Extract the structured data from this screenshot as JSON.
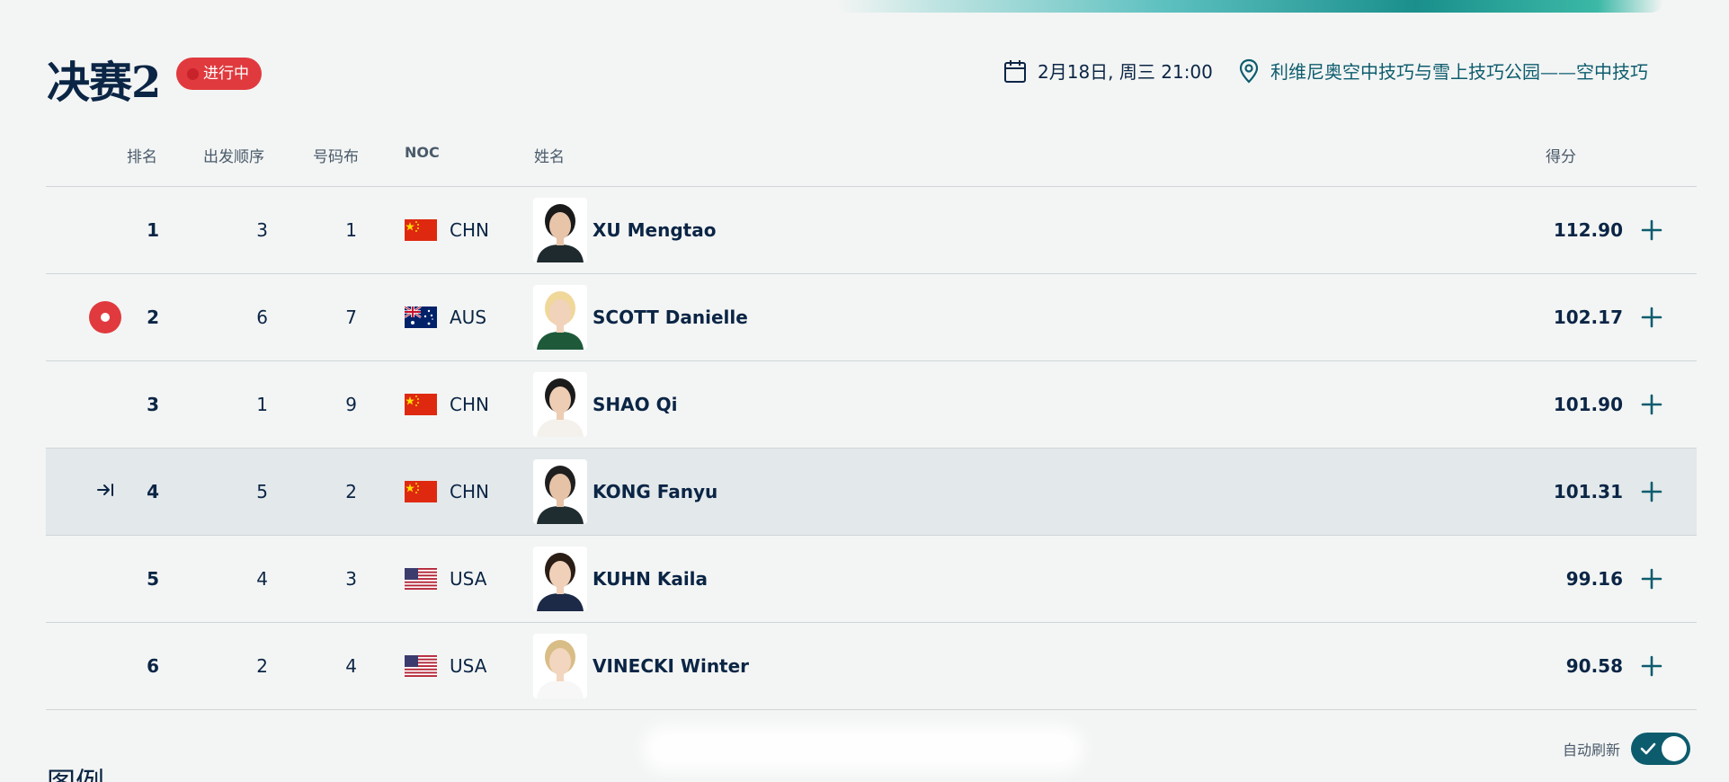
{
  "event": {
    "title": "决赛2",
    "status": "进行中",
    "datetime": "2月18日, 周三 21:00",
    "venue": "利维尼奥空中技巧与雪上技巧公园——空中技巧"
  },
  "columns": {
    "rank": "排名",
    "start_order": "出发顺序",
    "bib": "号码布",
    "noc": "NOC",
    "name": "姓名",
    "score": "得分"
  },
  "results": [
    {
      "rank": "1",
      "start_order": "3",
      "bib": "1",
      "noc": "CHN",
      "flag": "china",
      "name": "XU Mengtao",
      "score": "112.90",
      "marker": ""
    },
    {
      "rank": "2",
      "start_order": "6",
      "bib": "7",
      "noc": "AUS",
      "flag": "australia",
      "name": "SCOTT Danielle",
      "score": "102.17",
      "marker": "live-dot-icon"
    },
    {
      "rank": "3",
      "start_order": "1",
      "bib": "9",
      "noc": "CHN",
      "flag": "china",
      "name": "SHAO Qi",
      "score": "101.90",
      "marker": ""
    },
    {
      "rank": "4",
      "start_order": "5",
      "bib": "2",
      "noc": "CHN",
      "flag": "china",
      "name": "KONG Fanyu",
      "score": "101.31",
      "marker": "arrow-right-to-bar-icon"
    },
    {
      "rank": "5",
      "start_order": "4",
      "bib": "3",
      "noc": "USA",
      "flag": "usa",
      "name": "KUHN Kaila",
      "score": "99.16",
      "marker": ""
    },
    {
      "rank": "6",
      "start_order": "2",
      "bib": "4",
      "noc": "USA",
      "flag": "usa",
      "name": "VINECKI Winter",
      "score": "90.58",
      "marker": ""
    }
  ],
  "highlighted_row": 3,
  "autorefresh": {
    "label": "自动刷新",
    "enabled": true
  },
  "legend": {
    "title": "图例"
  },
  "colors": {
    "accent": "#0d5c6e",
    "live": "#e03a3e",
    "text": "#0b2545",
    "highlight_row": "#e3e8ea"
  }
}
